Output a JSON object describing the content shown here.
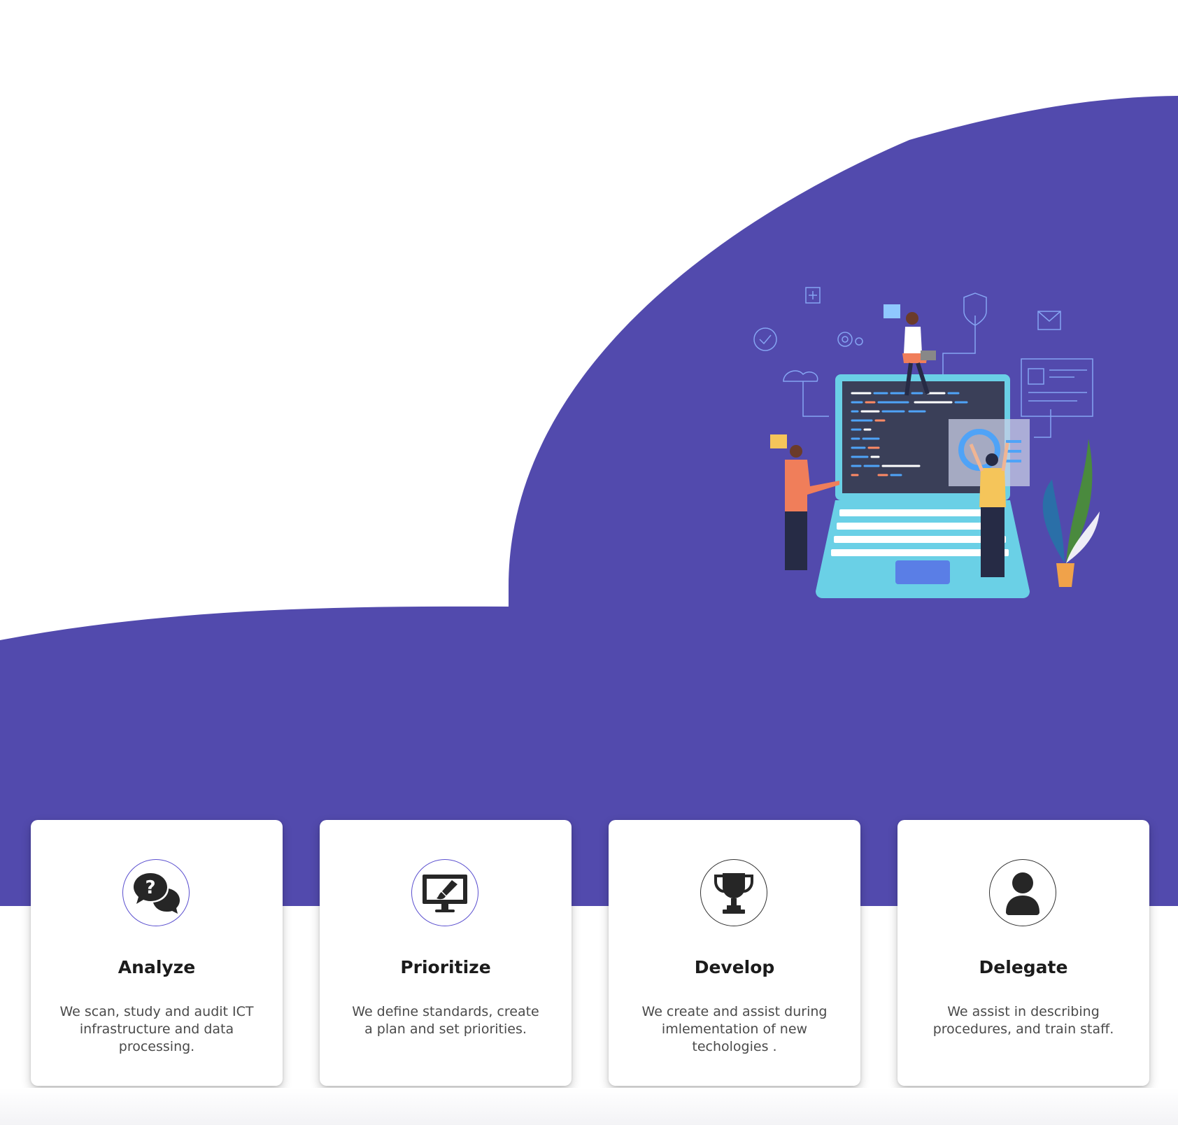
{
  "colors": {
    "brand": "#524aad",
    "card_background": "#ffffff",
    "title_text": "#1b1b1b",
    "body_text": "#4a4a4a",
    "icon_ring_purple": "#5a4fcf",
    "icon_ring_dark": "#333333"
  },
  "hero": {
    "illustration": "laptop-team-coding-illustration"
  },
  "cards": [
    {
      "icon": "question-chat-icon",
      "title": "Analyze",
      "text": "We scan, study and audit ICT\ninfrastructure and data\nprocessing."
    },
    {
      "icon": "monitor-brush-icon",
      "title": "Prioritize",
      "text": "We  define standards, create\na plan and set priorities."
    },
    {
      "icon": "trophy-icon",
      "title": "Develop",
      "text": "We create and assist during\nimlementation of new\ntechologies ."
    },
    {
      "icon": "user-icon",
      "title": "Delegate",
      "text": "We assist in describing\nprocedures, and train staff."
    }
  ]
}
